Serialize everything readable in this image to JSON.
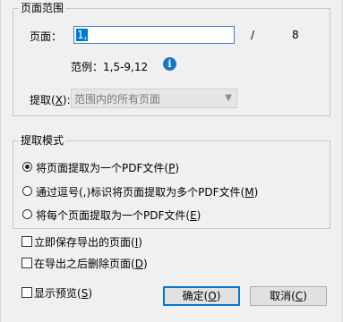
{
  "page_range": {
    "legend": "页面范围",
    "pages_label": "页面：",
    "pages_value": "1,",
    "slash": "/",
    "total_pages": "8",
    "example_text": "范例：1,5-9,12",
    "extract_label_prefix": "提取(",
    "extract_label_key": "X",
    "extract_label_suffix": "):",
    "extract_select_value": "范围内的所有页面"
  },
  "extract_mode": {
    "legend": "提取模式",
    "options": [
      {
        "prefix": "将页面提取为一个PDF文件(",
        "key": "P",
        "suffix": ")",
        "checked": true
      },
      {
        "prefix": "通过逗号(,)标识将页面提取为多个PDF文件(",
        "key": "M",
        "suffix": ")",
        "checked": false
      },
      {
        "prefix": "将每个页面提取为一个PDF文件(",
        "key": "E",
        "suffix": ")",
        "checked": false
      }
    ]
  },
  "options": {
    "save_immediately": {
      "prefix": "立即保存导出的页面(",
      "key": "I",
      "suffix": ")"
    },
    "delete_after": {
      "prefix": "在导出之后删除页面(",
      "key": "D",
      "suffix": ")"
    },
    "show_preview": {
      "prefix": "显示预览(",
      "key": "S",
      "suffix": ")"
    }
  },
  "buttons": {
    "ok": {
      "prefix": "确定(",
      "key": "O",
      "suffix": ")"
    },
    "cancel": {
      "prefix": "取消(",
      "key": "C",
      "suffix": ")"
    }
  },
  "icons": {
    "info": "info-icon",
    "dropdown": "chevron-down-icon"
  },
  "colors": {
    "accent": "#0078d7",
    "info_icon": "#1a73c9",
    "background": "#f0f0f0"
  }
}
